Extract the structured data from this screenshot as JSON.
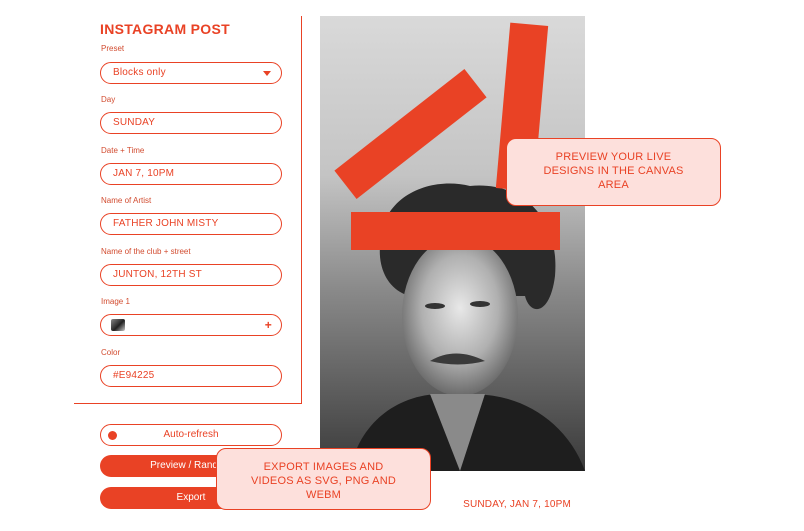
{
  "form": {
    "title": "INSTAGRAM POST",
    "preset_label": "Preset",
    "preset_value": "Blocks only",
    "day_label": "Day",
    "day_value": "SUNDAY",
    "datetime_label": "Date + Time",
    "datetime_value": "JAN 7, 10PM",
    "artist_label": "Name of Artist",
    "artist_value": "FATHER JOHN MISTY",
    "club_label": "Name of the club + street",
    "club_value": "JUNTON, 12TH ST",
    "image_label": "Image 1",
    "color_label": "Color",
    "color_value": "#E94225"
  },
  "actions": {
    "autorefresh_label": "Auto-refresh",
    "preview_label": "Preview / Random",
    "export_label": "Export"
  },
  "canvas": {
    "date_text": "SUNDAY, JAN 7, 10PM"
  },
  "callouts": {
    "preview_line1": "PREVIEW YOUR LIVE",
    "preview_line2": "DESIGNS IN THE CANVAS",
    "preview_line3": "AREA",
    "export_line1": "EXPORT IMAGES AND",
    "export_line2": "VIDEOS AS SVG, PNG AND",
    "export_line3": "WEBM"
  },
  "colors": {
    "accent": "#E94225",
    "callout_bg": "#FDE0DC"
  },
  "icons": {
    "preset_dropdown": "chevron-down-icon",
    "image_add": "plus-icon",
    "autorefresh_indicator": "dot-icon"
  }
}
